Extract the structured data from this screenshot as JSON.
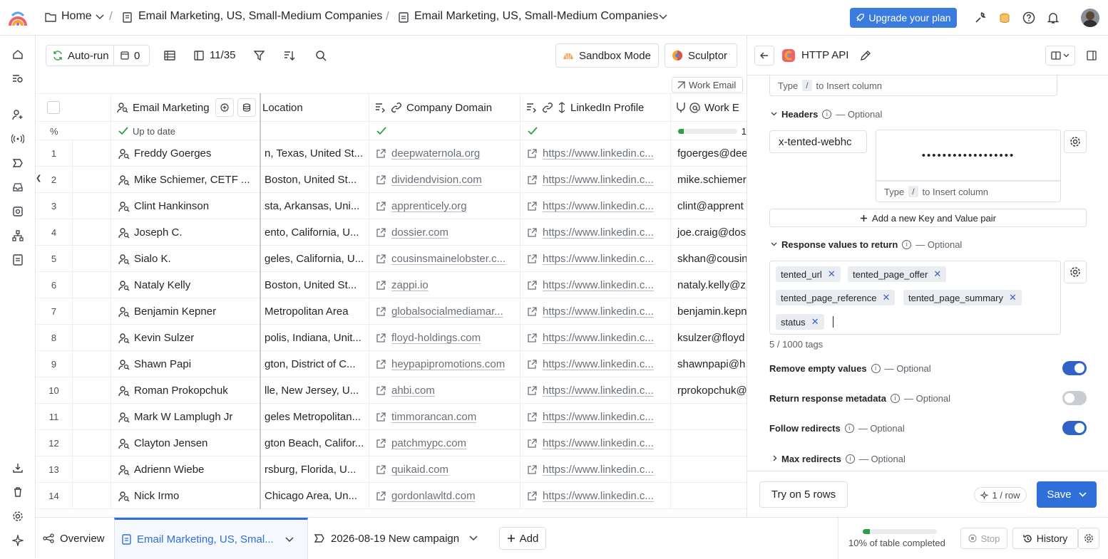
{
  "topbar": {
    "crumbs": [
      "Home",
      "Email Marketing, US, Small-Medium Companies",
      "Email Marketing, US, Small-Medium Companies"
    ],
    "upgrade_label": "Upgrade your plan"
  },
  "toolbar": {
    "autorun_label": "Auto-run",
    "count": "0",
    "columns_count": "11/35",
    "sandbox_label": "Sandbox Mode",
    "sculptor_label": "Sculptor",
    "work_email_chip": "Work Email"
  },
  "table": {
    "columns": [
      "Email Marketing",
      "Location",
      "Company Domain",
      "LinkedIn Profile",
      "Work E"
    ],
    "status_row": {
      "percent": "%",
      "name_status": "Up to date",
      "progress_text": "1"
    },
    "rows": [
      {
        "n": "1",
        "name": "Freddy Goerges",
        "location": "n, Texas, United St...",
        "domain": "deepwaternola.org",
        "linkedin": "https://www.linkedin.c...",
        "email": "fgoerges@dee"
      },
      {
        "n": "2",
        "name": "Mike Schiemer, CETF ...",
        "location": "Boston, United St...",
        "domain": "dividendvision.com",
        "linkedin": "https://www.linkedin.c...",
        "email": "mike.schiemer"
      },
      {
        "n": "3",
        "name": "Clint Hankinson",
        "location": "sta, Arkansas, Uni...",
        "domain": "apprenticely.org",
        "linkedin": "https://www.linkedin.c...",
        "email": "clint@apprent"
      },
      {
        "n": "4",
        "name": "Joseph C.",
        "location": "ento, California, U...",
        "domain": "dossier.com",
        "linkedin": "https://www.linkedin.c...",
        "email": "joe.craig@dos"
      },
      {
        "n": "5",
        "name": "Sialo K.",
        "location": "geles, California, U...",
        "domain": "cousinsmainelobster.c...",
        "linkedin": "https://www.linkedin.c...",
        "email": "skhan@cousin"
      },
      {
        "n": "6",
        "name": "Nataly Kelly",
        "location": "Boston, United St...",
        "domain": "zappi.io",
        "linkedin": "https://www.linkedin.c...",
        "email": "nataly.kelly@z"
      },
      {
        "n": "7",
        "name": "Benjamin Kepner",
        "location": "Metropolitan Area",
        "domain": "globalsocialmediamar...",
        "linkedin": "https://www.linkedin.c...",
        "email": "benjamin.kepn"
      },
      {
        "n": "8",
        "name": "Kevin Sulzer",
        "location": "polis, Indiana, Unit...",
        "domain": "floyd-holdings.com",
        "linkedin": "https://www.linkedin.c...",
        "email": "ksulzer@floyd"
      },
      {
        "n": "9",
        "name": "Shawn Papi",
        "location": "gton, District of C...",
        "domain": "heypapipromotions.com",
        "linkedin": "https://www.linkedin.c...",
        "email": "shawnpapi@h"
      },
      {
        "n": "10",
        "name": "Roman Prokopchuk",
        "location": "lle, New Jersey, U...",
        "domain": "ahbi.com",
        "linkedin": "https://www.linkedin.c...",
        "email": "rprokopchuk@"
      },
      {
        "n": "11",
        "name": "Mark W Lamplugh Jr",
        "location": "geles Metropolitan...",
        "domain": "timmorancan.com",
        "linkedin": "https://www.linkedin.c...",
        "email": ""
      },
      {
        "n": "12",
        "name": "Clayton Jensen",
        "location": "gton Beach, Califor...",
        "domain": "patchmypc.com",
        "linkedin": "https://www.linkedin.c...",
        "email": ""
      },
      {
        "n": "13",
        "name": "Adrienn Wiebe",
        "location": "rsburg, Florida, U...",
        "domain": "quikaid.com",
        "linkedin": "https://www.linkedin.c...",
        "email": ""
      },
      {
        "n": "14",
        "name": "Nick Irmo",
        "location": "Chicago Area, Un...",
        "domain": "gordonlawltd.com",
        "linkedin": "https://www.linkedin.c...",
        "email": ""
      }
    ]
  },
  "panel": {
    "title": "HTTP API",
    "type_hint_1": "Type",
    "type_hint_2": "to Insert column",
    "slash": "/",
    "headers_label": "Headers",
    "optional": "— Optional",
    "header_key": "x-tented-webhc",
    "header_value_mask": "••••••••••••••••••",
    "add_pair": "Add a new Key and Value pair",
    "response_label": "Response values to return",
    "tags": [
      "tented_url",
      "tented_page_offer",
      "tented_page_reference",
      "tented_page_summary",
      "status"
    ],
    "tag_count": "5 / 1000 tags",
    "remove_empty": "Remove empty values",
    "return_meta": "Return response metadata",
    "follow_redirects": "Follow redirects",
    "max_redirects": "Max redirects",
    "try_label": "Try on 5 rows",
    "rate": "1 / row",
    "save_label": "Save",
    "toggles": {
      "remove_empty": true,
      "return_meta": false,
      "follow_redirects": true
    }
  },
  "bottombar": {
    "overview": "Overview",
    "tab_active": "Email Marketing, US, Smal...",
    "tab_campaign": "2026-08-19 New campaign",
    "add": "Add",
    "progress_text": "10% of table completed",
    "progress_fraction": 0.1,
    "stop": "Stop",
    "history": "History"
  },
  "colors": {
    "accent": "#2f6fd9",
    "toggle_on": "#2f63c9",
    "progress": "#2e9e44"
  }
}
